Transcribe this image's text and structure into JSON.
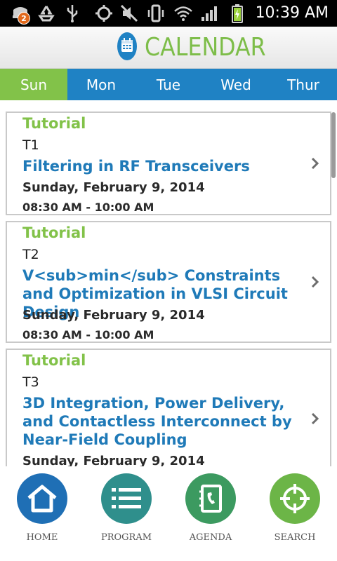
{
  "status_bar": {
    "time": "10:39 AM",
    "notification_count": "2",
    "icons": [
      "notification-icon",
      "recycle-icon",
      "usb-icon",
      "gps-icon",
      "mute-icon",
      "vibrate-icon",
      "wifi-icon",
      "signal-icon",
      "battery-charging-icon"
    ]
  },
  "header": {
    "title": "CALENDAR",
    "logo_icon": "calendar-icon"
  },
  "day_tabs": [
    {
      "label": "Sun",
      "active": true
    },
    {
      "label": "Mon",
      "active": false
    },
    {
      "label": "Tue",
      "active": false
    },
    {
      "label": "Wed",
      "active": false
    },
    {
      "label": "Thur",
      "active": false
    }
  ],
  "sessions": [
    {
      "category": "Tutorial",
      "code": "T1",
      "title": "Filtering in RF Transceivers",
      "date": "Sunday, February 9, 2014",
      "time": "08:30 AM - 10:00 AM"
    },
    {
      "category": "Tutorial",
      "code": "T2",
      "title": "V<sub>min</sub> Constraints and Optimization in VLSI Circuit Design",
      "date": "Sunday, February 9, 2014",
      "time": "08:30 AM - 10:00 AM"
    },
    {
      "category": "Tutorial",
      "code": "T3",
      "title": "3D Integration, Power Delivery, and Contactless Interconnect by Near-Field Coupling",
      "date": "Sunday, February 9, 2014",
      "time": ""
    }
  ],
  "bottom_nav": [
    {
      "label": "HOME",
      "icon": "home-icon",
      "color": "#1f6fb5"
    },
    {
      "label": "PROGRAM",
      "icon": "list-icon",
      "color": "#2f8f8c"
    },
    {
      "label": "AGENDA",
      "icon": "phone-book-icon",
      "color": "#3c9a60"
    },
    {
      "label": "SEARCH",
      "icon": "crosshair-icon",
      "color": "#6cb547"
    }
  ],
  "colors": {
    "accent_green": "#82c249",
    "accent_blue": "#1f82c4",
    "title_blue": "#1f7ab8"
  }
}
